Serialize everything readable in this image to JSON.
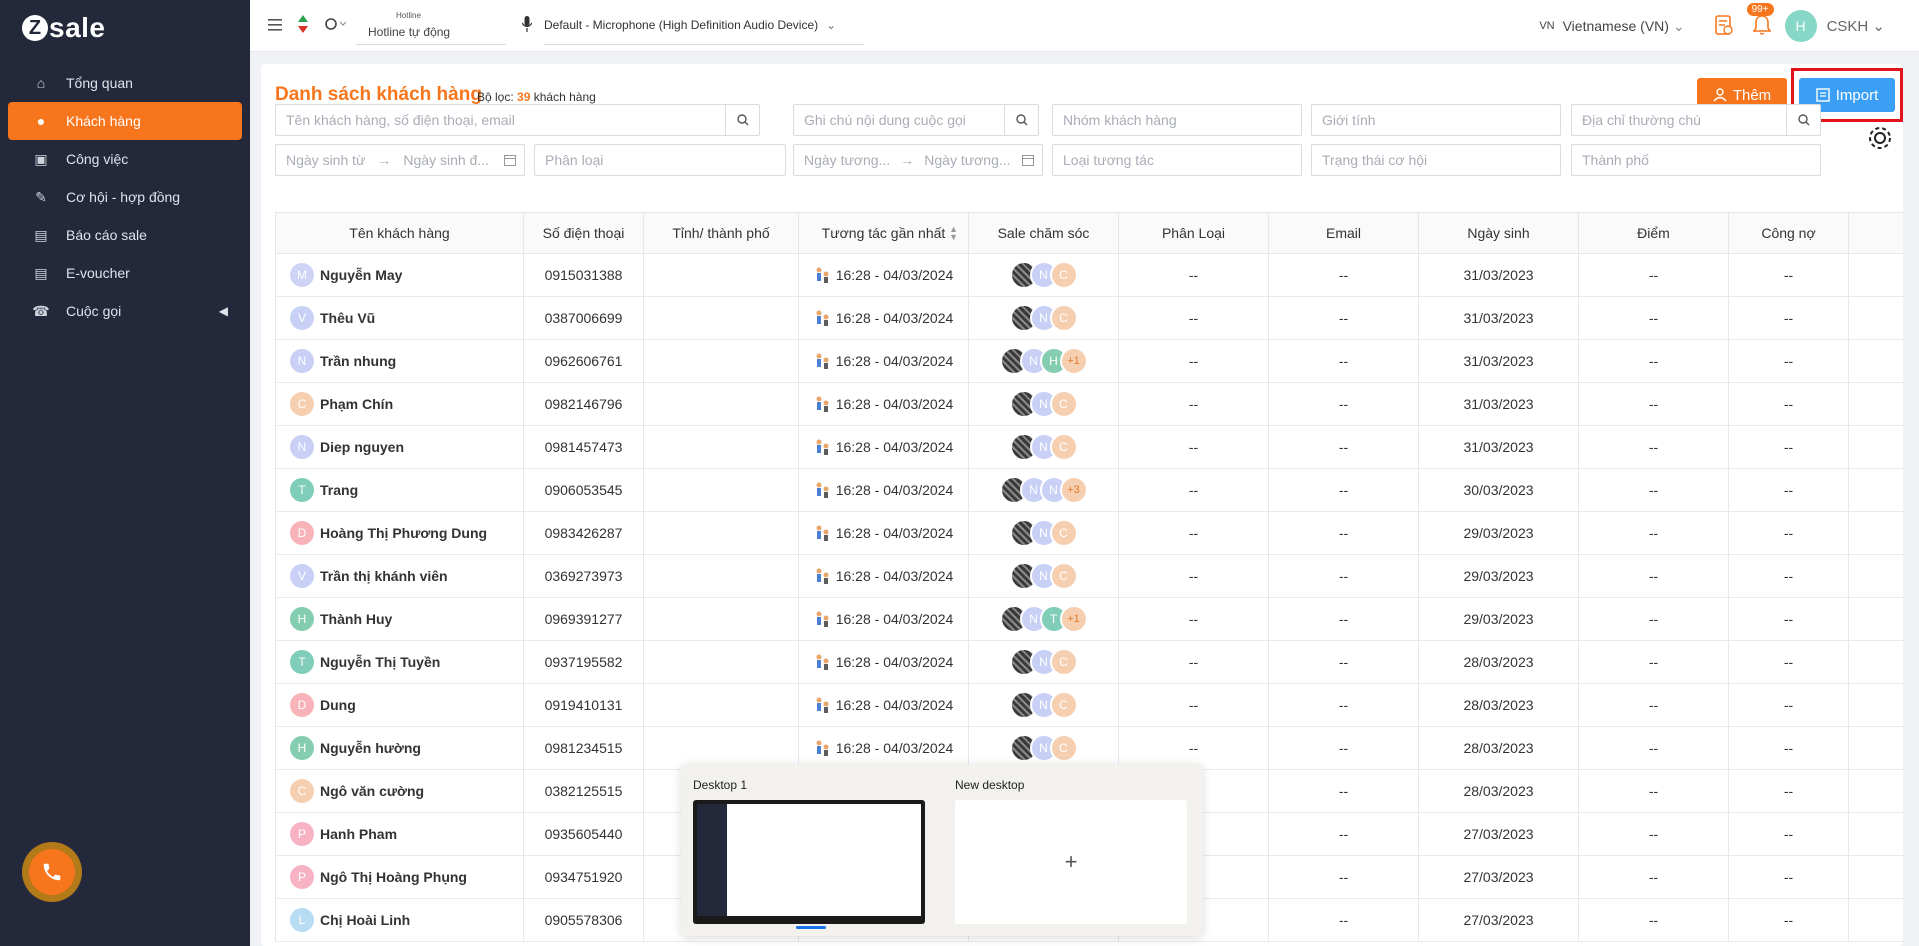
{
  "brand": {
    "logo_letter": "Z",
    "logo_text": "sale"
  },
  "sidebar": {
    "items": [
      {
        "label": "Tổng quan",
        "icon": "home-icon"
      },
      {
        "label": "Khách hàng",
        "icon": "users-icon",
        "active": true
      },
      {
        "label": "Công việc",
        "icon": "briefcase-icon"
      },
      {
        "label": "Cơ hội - hợp đồng",
        "icon": "contract-icon"
      },
      {
        "label": "Báo cáo sale",
        "icon": "report-icon"
      },
      {
        "label": "E-voucher",
        "icon": "voucher-icon"
      },
      {
        "label": "Cuộc gọi",
        "icon": "phone-book-icon",
        "has_submenu": true
      }
    ]
  },
  "topbar": {
    "hotline_label": "Hotline",
    "hotline_value": "Hotline tự động",
    "mic_device": "Default - Microphone (High Definition Audio Device)",
    "lang_code": "VN",
    "language": "Vietnamese (VN)",
    "notification_count": "99+",
    "avatar_initial": "H",
    "user_name": "CSKH"
  },
  "page": {
    "title": "Danh sách khách hàng",
    "filter_prefix": "Bộ lọc:",
    "filter_count": "39",
    "filter_suffix": "khách hàng",
    "add_button": "Thêm",
    "import_button": "Import"
  },
  "filters": {
    "search": "Tên khách hàng, số điện thoại, email",
    "call_note": "Ghi chú nội dung cuộc gọi",
    "group": "Nhóm khách hàng",
    "gender": "Giới tính",
    "address": "Địa chỉ thường chú",
    "dob_from": "Ngày sinh từ",
    "dob_to": "Ngày sinh đ...",
    "classify": "Phân loại",
    "interact_from": "Ngày tương...",
    "interact_to": "Ngày tương...",
    "interact_type": "Loại tương tác",
    "opportunity_status": "Trạng thái cơ hội",
    "city": "Thành phố"
  },
  "table": {
    "columns": [
      "Tên khách hàng",
      "Số điện thoại",
      "Tỉnh/ thành phố",
      "Tương tác gần nhất",
      "Sale chăm sóc",
      "Phân Loại",
      "Email",
      "Ngày sinh",
      "Điểm",
      "Công nợ"
    ],
    "rows": [
      {
        "initial": "M",
        "name": "Nguyễn May",
        "phone": "0915031388",
        "city": "",
        "interaction": "16:28 - 04/03/2024",
        "sales": [
          "img",
          "n",
          "c"
        ],
        "classify": "--",
        "email": "--",
        "dob": "31/03/2023",
        "points": "--",
        "debt": "--"
      },
      {
        "initial": "V",
        "name": "Thêu Vũ",
        "phone": "0387006699",
        "city": "",
        "interaction": "16:28 - 04/03/2024",
        "sales": [
          "img",
          "n",
          "c"
        ],
        "classify": "--",
        "email": "--",
        "dob": "31/03/2023",
        "points": "--",
        "debt": "--"
      },
      {
        "initial": "N",
        "name": "Trần nhung",
        "phone": "0962606761",
        "city": "",
        "interaction": "16:28 - 04/03/2024",
        "sales": [
          "img",
          "n",
          "h",
          "+1"
        ],
        "classify": "--",
        "email": "--",
        "dob": "31/03/2023",
        "points": "--",
        "debt": "--"
      },
      {
        "initial": "C",
        "name": "Phạm Chín",
        "phone": "0982146796",
        "city": "",
        "interaction": "16:28 - 04/03/2024",
        "sales": [
          "img",
          "n",
          "c"
        ],
        "classify": "--",
        "email": "--",
        "dob": "31/03/2023",
        "points": "--",
        "debt": "--"
      },
      {
        "initial": "N",
        "name": "Diep nguyen",
        "phone": "0981457473",
        "city": "",
        "interaction": "16:28 - 04/03/2024",
        "sales": [
          "img",
          "n",
          "c"
        ],
        "classify": "--",
        "email": "--",
        "dob": "31/03/2023",
        "points": "--",
        "debt": "--"
      },
      {
        "initial": "T",
        "name": "Trang",
        "phone": "0906053545",
        "city": "",
        "interaction": "16:28 - 04/03/2024",
        "sales": [
          "img",
          "n",
          "n",
          "+3"
        ],
        "classify": "--",
        "email": "--",
        "dob": "30/03/2023",
        "points": "--",
        "debt": "--"
      },
      {
        "initial": "D",
        "name": "Hoàng Thị Phương Dung",
        "phone": "0983426287",
        "city": "",
        "interaction": "16:28 - 04/03/2024",
        "sales": [
          "img",
          "n",
          "c"
        ],
        "classify": "--",
        "email": "--",
        "dob": "29/03/2023",
        "points": "--",
        "debt": "--"
      },
      {
        "initial": "V",
        "name": "Trần thị khánh viên",
        "phone": "0369273973",
        "city": "",
        "interaction": "16:28 - 04/03/2024",
        "sales": [
          "img",
          "n",
          "c"
        ],
        "classify": "--",
        "email": "--",
        "dob": "29/03/2023",
        "points": "--",
        "debt": "--"
      },
      {
        "initial": "H",
        "name": "Thành Huy",
        "phone": "0969391277",
        "city": "",
        "interaction": "16:28 - 04/03/2024",
        "sales": [
          "img",
          "n",
          "t",
          "+1"
        ],
        "classify": "--",
        "email": "--",
        "dob": "29/03/2023",
        "points": "--",
        "debt": "--"
      },
      {
        "initial": "T",
        "name": "Nguyễn Thị Tuyền",
        "phone": "0937195582",
        "city": "",
        "interaction": "16:28 - 04/03/2024",
        "sales": [
          "img",
          "n",
          "c"
        ],
        "classify": "--",
        "email": "--",
        "dob": "28/03/2023",
        "points": "--",
        "debt": "--"
      },
      {
        "initial": "D",
        "name": "Dung",
        "phone": "0919410131",
        "city": "",
        "interaction": "16:28 - 04/03/2024",
        "sales": [
          "img",
          "n",
          "c"
        ],
        "classify": "--",
        "email": "--",
        "dob": "28/03/2023",
        "points": "--",
        "debt": "--"
      },
      {
        "initial": "H",
        "name": "Nguyễn hường",
        "phone": "0981234515",
        "city": "",
        "interaction": "16:28 - 04/03/2024",
        "sales": [
          "img",
          "n",
          "c"
        ],
        "classify": "--",
        "email": "--",
        "dob": "28/03/2023",
        "points": "--",
        "debt": "--"
      },
      {
        "initial": "C",
        "name": "Ngô văn cường",
        "phone": "0382125515",
        "city": "",
        "interaction": "",
        "sales": [],
        "classify": "--",
        "email": "--",
        "dob": "28/03/2023",
        "points": "--",
        "debt": "--"
      },
      {
        "initial": "P",
        "name": "Hanh Pham",
        "phone": "0935605440",
        "city": "",
        "interaction": "",
        "sales": [],
        "classify": "--",
        "email": "--",
        "dob": "27/03/2023",
        "points": "--",
        "debt": "--"
      },
      {
        "initial": "P",
        "name": "Ngô Thị Hoàng Phụng",
        "phone": "0934751920",
        "city": "",
        "interaction": "",
        "sales": [],
        "classify": "--",
        "email": "--",
        "dob": "27/03/2023",
        "points": "--",
        "debt": "--"
      },
      {
        "initial": "L",
        "name": "Chị Hoài Linh",
        "phone": "0905578306",
        "city": "",
        "interaction": "",
        "sales": [],
        "classify": "--",
        "email": "--",
        "dob": "27/03/2023",
        "points": "--",
        "debt": "--"
      }
    ]
  },
  "desktops": {
    "desktop1_label": "Desktop 1",
    "new_desktop_label": "New desktop",
    "add_symbol": "+"
  },
  "colors": {
    "accent": "#f7761d",
    "sidebar_bg": "#24283b",
    "import_blue": "#3a9ff5",
    "highlight_red": "#e2131b"
  }
}
